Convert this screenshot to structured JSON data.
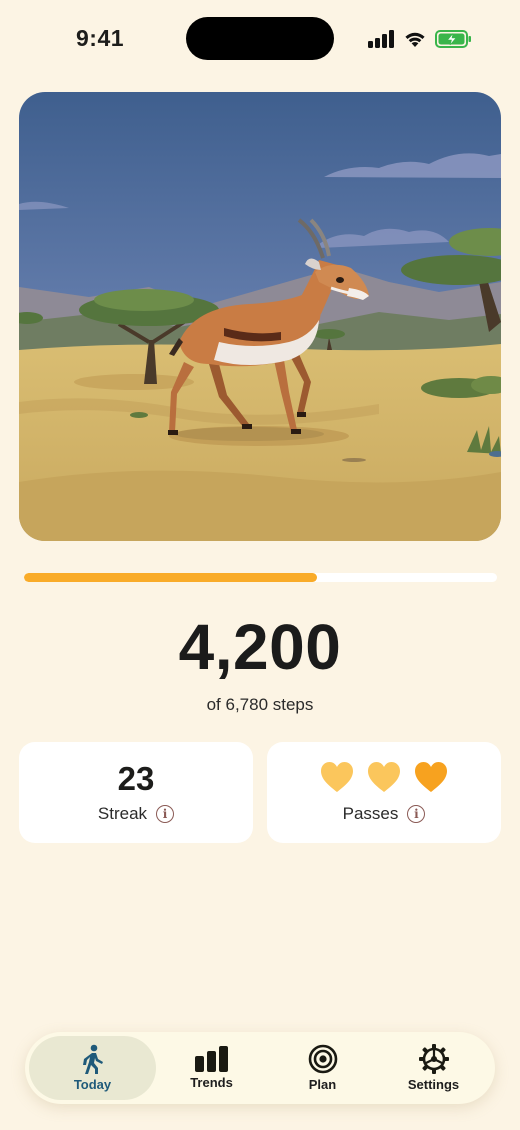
{
  "status_bar": {
    "time": "9:41"
  },
  "progress": {
    "fraction": 0.62
  },
  "steps": {
    "value": "4,200",
    "caption": "of 6,780 steps"
  },
  "streak": {
    "value": "23",
    "label": "Streak"
  },
  "passes": {
    "label": "Passes",
    "hearts": [
      "used",
      "used",
      "available"
    ]
  },
  "tabs": [
    {
      "label": "Today",
      "icon": "walking-icon",
      "active": true
    },
    {
      "label": "Trends",
      "icon": "bar-chart-icon",
      "active": false
    },
    {
      "label": "Plan",
      "icon": "target-icon",
      "active": false
    },
    {
      "label": "Settings",
      "icon": "gear-icon",
      "active": false
    }
  ],
  "colors": {
    "background": "#fcf4e4",
    "accent": "#f9ab28",
    "heart_used": "#fbc65c",
    "heart_available": "#f7a21f",
    "active_tab": "#1f5a7a"
  }
}
